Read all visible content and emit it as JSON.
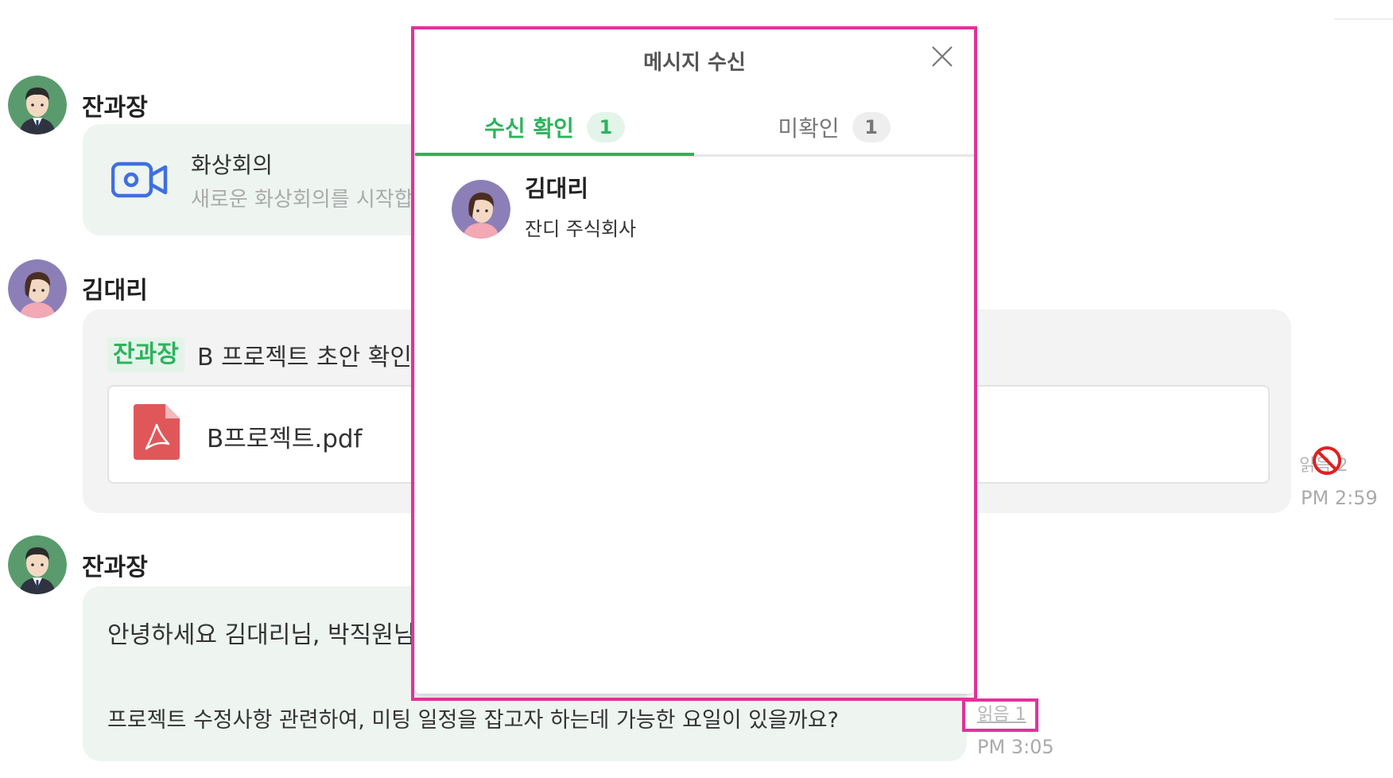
{
  "messages": [
    {
      "sender": "잔과장",
      "video_call": {
        "title": "화상회의",
        "subtitle": "새로운 화상회의를 시작합니다"
      }
    },
    {
      "sender": "김대리",
      "mention": "잔과장",
      "text": "B 프로젝트 초안 확인 부탁드립니다",
      "file": {
        "name": "B프로젝트.pdf"
      },
      "read_label": "읽음 2",
      "time": "PM 2:59"
    },
    {
      "sender": "잔과장",
      "line1": "안녕하세요 김대리님, 박직원님",
      "line2": "프로젝트 수정사항 관련하여, 미팅 일정을 잡고자 하는데 가능한 요일이 있을까요?",
      "read_label": "읽음 1",
      "time": "PM 3:05"
    }
  ],
  "modal": {
    "title": "메시지 수신",
    "tabs": [
      {
        "label": "수신 확인",
        "count": "1",
        "active": true
      },
      {
        "label": "미확인",
        "count": "1",
        "active": false
      }
    ],
    "members": [
      {
        "name": "김대리",
        "company": "잔디 주식회사"
      }
    ]
  },
  "colors": {
    "accent": "#2db35d",
    "highlight": "#e0339b",
    "bubble": "#eef5f1",
    "video_icon": "#3f6fe0",
    "pdf": "#e0575a"
  }
}
